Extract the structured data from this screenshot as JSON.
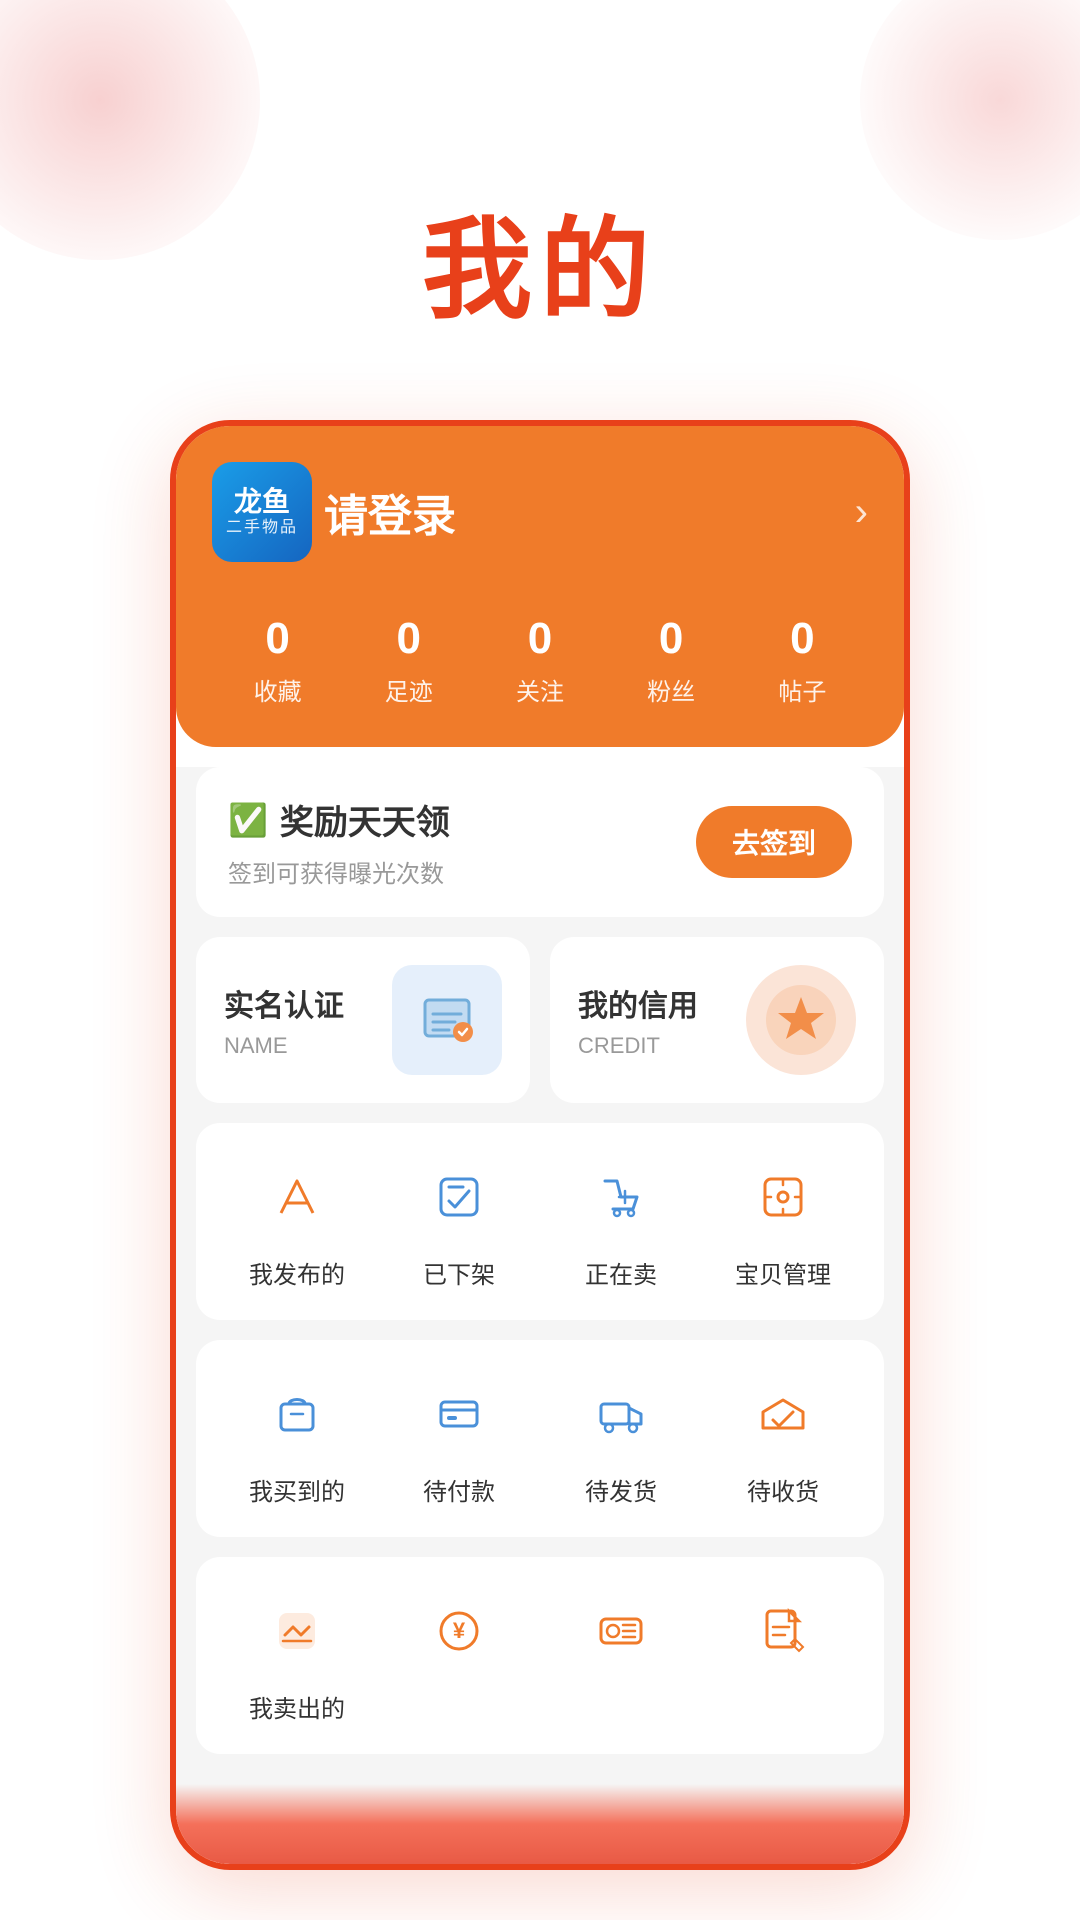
{
  "page": {
    "title": "我的"
  },
  "header": {
    "logo": {
      "name": "龙鱼",
      "subtitle": "二手物品"
    },
    "login_text": "请登录",
    "chevron": "›"
  },
  "stats": [
    {
      "id": "favorites",
      "count": "0",
      "label": "收藏"
    },
    {
      "id": "footprint",
      "count": "0",
      "label": "足迹"
    },
    {
      "id": "following",
      "count": "0",
      "label": "关注"
    },
    {
      "id": "fans",
      "count": "0",
      "label": "粉丝"
    },
    {
      "id": "posts",
      "count": "0",
      "label": "帖子"
    }
  ],
  "reward": {
    "icon": "📅",
    "title": "奖励天天领",
    "desc": "签到可获得曝光次数",
    "btn_label": "去签到"
  },
  "credit_cards": [
    {
      "id": "real-name",
      "title": "实名认证",
      "subtitle": "NAME",
      "icon_type": "blue"
    },
    {
      "id": "my-credit",
      "title": "我的信用",
      "subtitle": "CREDIT",
      "icon_type": "orange"
    }
  ],
  "sell_functions": [
    {
      "id": "my-published",
      "label": "我发布的",
      "icon": "📤"
    },
    {
      "id": "shelved-off",
      "label": "已下架",
      "icon": "🛍"
    },
    {
      "id": "on-sale",
      "label": "正在卖",
      "icon": "🛒"
    },
    {
      "id": "item-manage",
      "label": "宝贝管理",
      "icon": "🔧"
    }
  ],
  "buy_functions": [
    {
      "id": "my-bought",
      "label": "我买到的",
      "icon": "📦"
    },
    {
      "id": "pending-payment",
      "label": "待付款",
      "icon": "💳"
    },
    {
      "id": "pending-ship",
      "label": "待发货",
      "icon": "🚚"
    },
    {
      "id": "pending-receive",
      "label": "待收货",
      "icon": "🚛"
    }
  ],
  "sold_functions": [
    {
      "id": "my-sold",
      "label": "我卖出的",
      "icon": "🛍"
    },
    {
      "id": "income",
      "label": "",
      "icon": "💰"
    },
    {
      "id": "coupons",
      "label": "",
      "icon": "🎫"
    },
    {
      "id": "drafts",
      "label": "",
      "icon": "📝"
    }
  ]
}
